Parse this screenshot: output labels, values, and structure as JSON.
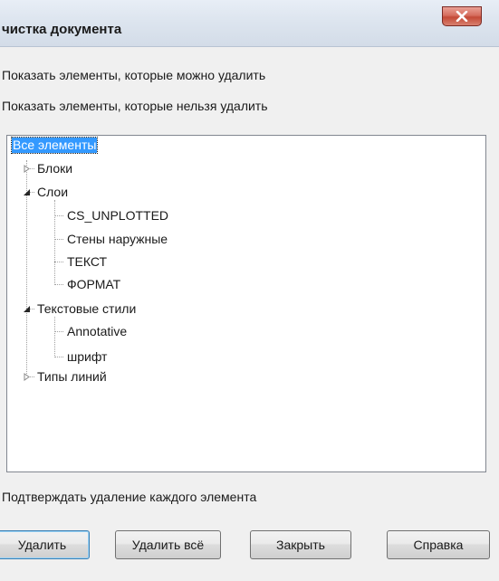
{
  "window": {
    "title": "чистка документа",
    "close_label": "X"
  },
  "options": {
    "show_deletable": "Показать элементы, которые можно удалить",
    "show_nondeletable": "Показать элементы, которые нельзя удалить",
    "confirm_each": "Подтверждать удаление каждого элемента"
  },
  "tree": {
    "root": "Все элементы",
    "blocks": "Блоки",
    "layers": "Слои",
    "layer_items": [
      "CS_UNPLOTTED",
      "Стены наружные",
      "ТЕКСТ",
      "ФОРМАТ"
    ],
    "text_styles": "Текстовые стили",
    "text_style_items": [
      "Annotative",
      "шрифт"
    ],
    "line_types": "Типы линий"
  },
  "buttons": {
    "delete": "Удалить",
    "delete_all": "Удалить всё",
    "close": "Закрыть",
    "help": "Справка"
  }
}
